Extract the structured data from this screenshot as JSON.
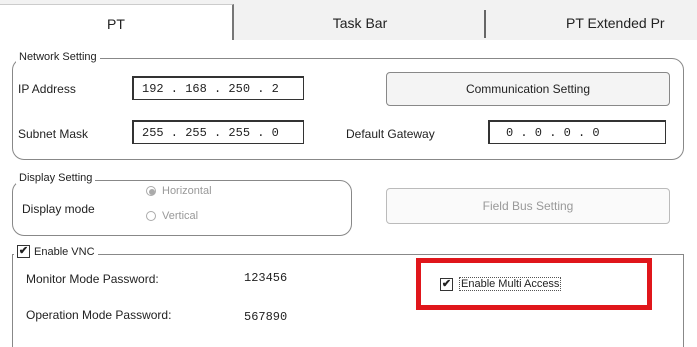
{
  "tabs": [
    {
      "label": "PT"
    },
    {
      "label": "Task Bar"
    },
    {
      "label": "PT Extended Pr"
    }
  ],
  "network": {
    "legend": "Network Setting",
    "ip_label": "IP Address",
    "ip_value": "192 . 168 . 250 . 2",
    "comm_button": "Communication Setting",
    "subnet_label": "Subnet Mask",
    "subnet_value": "255 . 255 . 255 . 0",
    "gateway_label": "Default Gateway",
    "gateway_value": "0 . 0 . 0 . 0"
  },
  "display": {
    "legend": "Display Setting",
    "mode_label": "Display mode",
    "options": [
      {
        "label": "Horizontal",
        "selected": true
      },
      {
        "label": "Vertical",
        "selected": false
      }
    ],
    "fieldbus_button": "Field Bus Setting"
  },
  "vnc": {
    "enable_label": "Enable VNC",
    "enable_checked": true,
    "monitor_label": "Monitor Mode Password:",
    "monitor_value": "123456",
    "operation_label": "Operation Mode Password:",
    "operation_value": "567890",
    "multi_access_label": "Enable Multi Access",
    "multi_access_checked": true
  },
  "colors": {
    "highlight": "#e0161b"
  }
}
